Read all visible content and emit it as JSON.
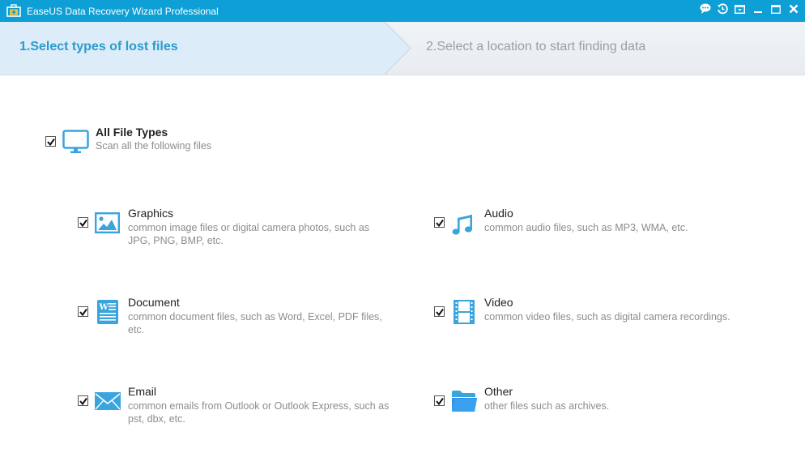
{
  "window": {
    "title": "EaseUS Data Recovery Wizard Professional",
    "accent_color": "#0e9fd6",
    "controls": [
      {
        "name": "feedback-icon"
      },
      {
        "name": "history-icon"
      },
      {
        "name": "menu-icon"
      },
      {
        "name": "minimize-icon"
      },
      {
        "name": "maximize-icon"
      },
      {
        "name": "close-icon"
      }
    ]
  },
  "steps": [
    {
      "label": "1.Select types of lost files",
      "active": true
    },
    {
      "label": "2.Select a location to start finding data",
      "active": false
    }
  ],
  "all_types": {
    "title": "All File Types",
    "description": "Scan all the following files",
    "checked": true
  },
  "file_types": [
    {
      "title": "Graphics",
      "description_line1": "common image files or digital camera photos, such as",
      "description_line2": "JPG, PNG, BMP, etc.",
      "icon": "image-icon",
      "checked": true
    },
    {
      "title": "Audio",
      "description_line1": "common audio files, such as MP3, WMA, etc.",
      "description_line2": "",
      "icon": "music-note-icon",
      "checked": true
    },
    {
      "title": "Document",
      "description_line1": "common document files, such as Word, Excel, PDF files,",
      "description_line2": "etc.",
      "icon": "document-icon",
      "checked": true
    },
    {
      "title": "Video",
      "description_line1": "common video files, such as digital camera recordings.",
      "description_line2": "",
      "icon": "film-icon",
      "checked": true
    },
    {
      "title": "Email",
      "description_line1": "common emails from Outlook or Outlook Express, such as",
      "description_line2": "pst, dbx, etc.",
      "icon": "envelope-icon",
      "checked": true
    },
    {
      "title": "Other",
      "description_line1": "other files such as archives.",
      "description_line2": "",
      "icon": "folder-icon",
      "checked": true
    }
  ]
}
